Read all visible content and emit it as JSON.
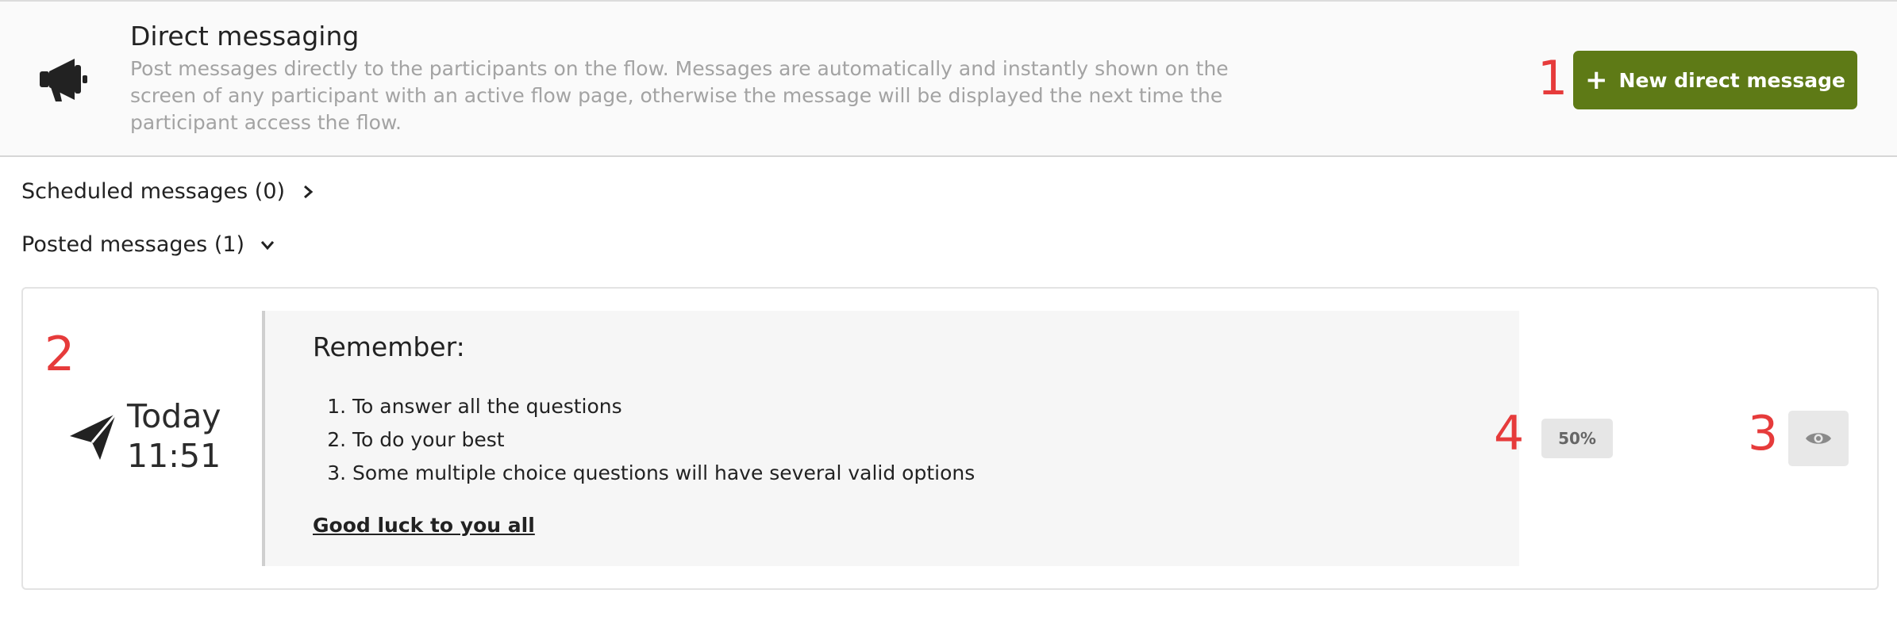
{
  "header": {
    "title": "Direct messaging",
    "description": "Post messages directly to the participants on the flow. Messages are automatically and instantly shown on the screen of any participant with an active flow page, otherwise the message will be displayed the next time the participant access the flow.",
    "icon": "megaphone-icon",
    "new_button": {
      "label": "New direct message",
      "icon": "plus-icon"
    }
  },
  "sections": {
    "scheduled": {
      "label": "Scheduled messages (0)",
      "icon": "chevron-right-icon"
    },
    "posted": {
      "label": "Posted messages (1)",
      "icon": "chevron-down-icon"
    }
  },
  "posted_message": {
    "icon": "paper-plane-icon",
    "day": "Today",
    "time": "11:51",
    "title": "Remember:",
    "items": [
      "To answer all the questions",
      "To do your best",
      "Some multiple choice questions will have several valid options"
    ],
    "footer": "Good luck to you all",
    "read_percent": "50%",
    "view_icon": "eye-icon"
  },
  "annotations": [
    "1",
    "2",
    "3",
    "4"
  ],
  "colors": {
    "accent_button": "#5e7a16",
    "annotation": "#e63b3b",
    "description_text": "#a3a3a3"
  }
}
